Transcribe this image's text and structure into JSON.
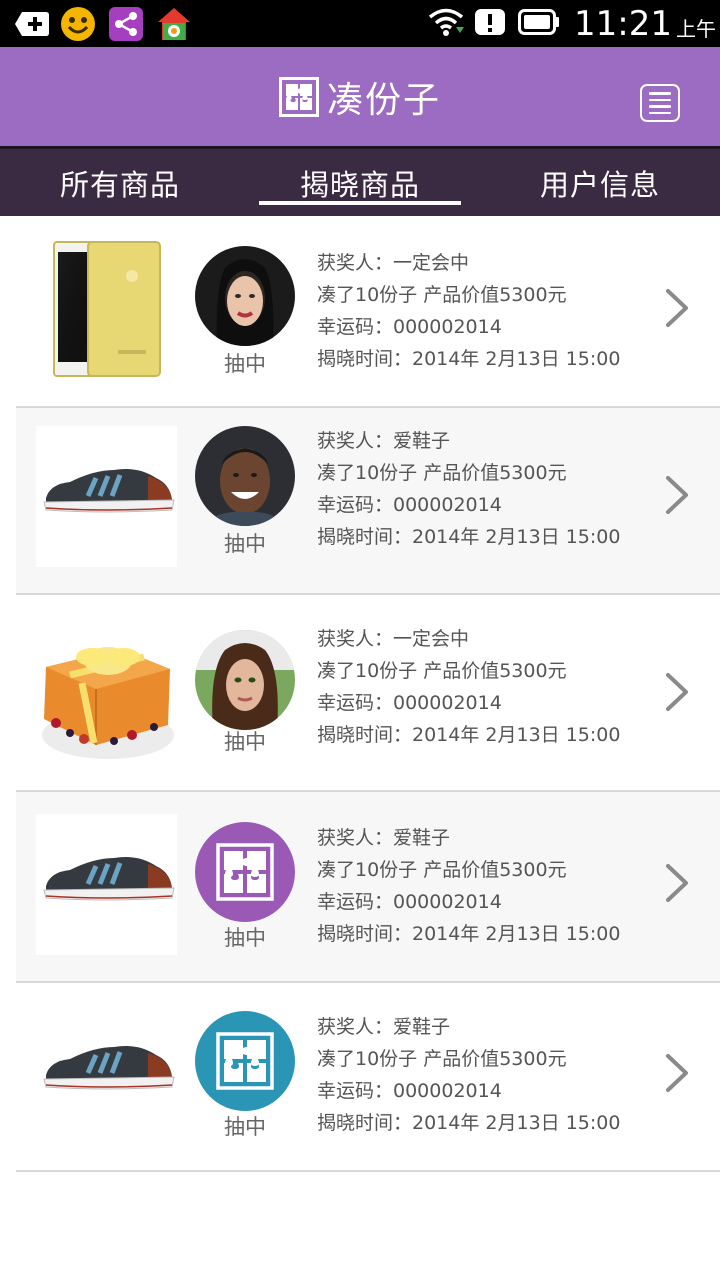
{
  "status_bar": {
    "time": "11:21",
    "ampm": "上午",
    "left_icons": [
      "add-box-icon",
      "smiley-icon",
      "share-app-icon",
      "home-settings-icon"
    ],
    "right_icons": [
      "wifi-icon",
      "alert-icon",
      "battery-icon"
    ]
  },
  "header": {
    "title": "凑份子",
    "logo_icon": "puzzle-logo-icon",
    "menu_icon": "list-menu-icon"
  },
  "tabs": [
    {
      "label": "所有商品",
      "active": false
    },
    {
      "label": "揭晓商品",
      "active": true
    },
    {
      "label": "用户信息",
      "active": false
    }
  ],
  "colors": {
    "brand": "#9b6cc1",
    "tab_bg": "#3a2a42",
    "logo_purple": "#9b59b6",
    "logo_teal": "#2b95b5"
  },
  "records": [
    {
      "product": "iphone-gold",
      "avatar": "woman-dark-hair",
      "avatar_label": "抽中",
      "winner": "获奖人：一定会中",
      "portions": "凑了10份子  产品价值5300元",
      "lucky_code": "幸运码：000002014",
      "reveal_time": "揭晓时间：2014年 2月13日 15:00"
    },
    {
      "product": "sneaker",
      "avatar": "man-smiling",
      "avatar_label": "抽中",
      "winner": "获奖人：爱鞋子",
      "portions": "凑了10份子  产品价值5300元",
      "lucky_code": "幸运码：000002014",
      "reveal_time": "揭晓时间：2014年 2月13日 15:00"
    },
    {
      "product": "cake",
      "avatar": "woman-brown-hair",
      "avatar_label": "抽中",
      "winner": "获奖人：一定会中",
      "portions": "凑了10份子  产品价值5300元",
      "lucky_code": "幸运码：000002014",
      "reveal_time": "揭晓时间：2014年 2月13日 15:00"
    },
    {
      "product": "sneaker",
      "avatar": "logo-purple",
      "avatar_label": "抽中",
      "winner": "获奖人：爱鞋子",
      "portions": "凑了10份子  产品价值5300元",
      "lucky_code": "幸运码：000002014",
      "reveal_time": "揭晓时间：2014年 2月13日 15:00"
    },
    {
      "product": "sneaker",
      "avatar": "logo-teal",
      "avatar_label": "抽中",
      "winner": "获奖人：爱鞋子",
      "portions": "凑了10份子  产品价值5300元",
      "lucky_code": "幸运码：000002014",
      "reveal_time": "揭晓时间：2014年 2月13日 15:00"
    }
  ]
}
